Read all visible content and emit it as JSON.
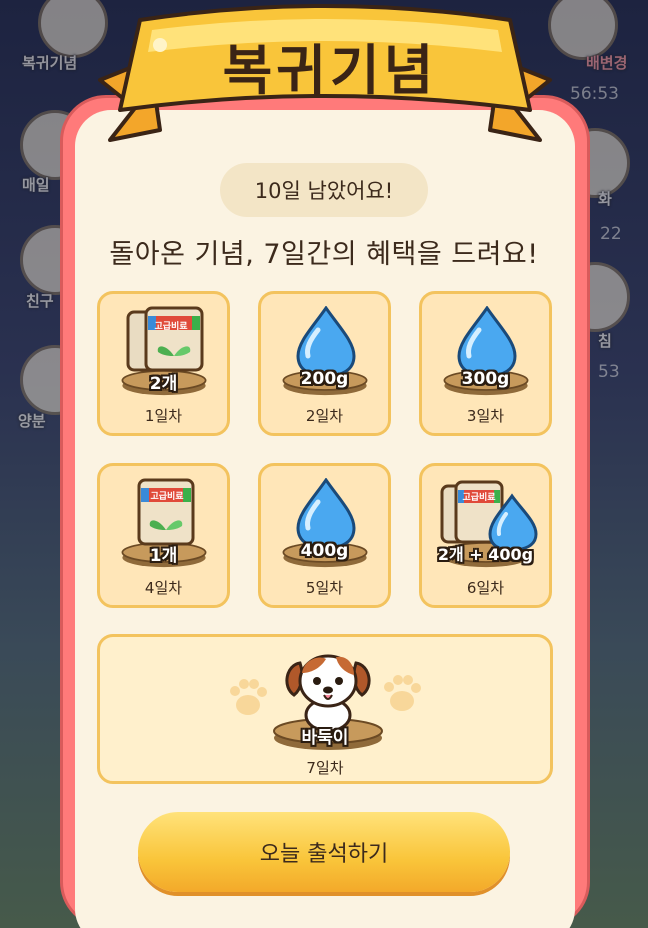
{
  "background": {
    "left_labels": [
      "복귀기념",
      "매일",
      "친구",
      "양분"
    ],
    "right_labels": [
      "배변경",
      "화",
      "침"
    ],
    "timers": [
      "56:53",
      "22",
      "53"
    ]
  },
  "modal": {
    "title": "복귀기념",
    "days_left": "10일 남았어요!",
    "subtitle": "돌아온 기념, 7일간의 혜택을 드려요!",
    "rewards": [
      {
        "day": "1일차",
        "qty": "2개",
        "icon": "fertilizer-bag-icon",
        "bag_label": "고급비료"
      },
      {
        "day": "2일차",
        "qty": "200g",
        "icon": "water-drop-icon"
      },
      {
        "day": "3일차",
        "qty": "300g",
        "icon": "water-drop-icon"
      },
      {
        "day": "4일차",
        "qty": "1개",
        "icon": "fertilizer-bag-icon",
        "bag_label": "고급비료"
      },
      {
        "day": "5일차",
        "qty": "400g",
        "icon": "water-drop-icon"
      },
      {
        "day": "6일차",
        "qty": "2개 + 400g",
        "icon": "fertilizer-and-water-icon",
        "bag_label": "고급비료"
      },
      {
        "day": "7일차",
        "qty": "바둑이",
        "icon": "puppy-icon"
      }
    ],
    "attend_button": "오늘 출석하기"
  },
  "colors": {
    "frame": "#ff7a7a",
    "panel": "#fbf3e2",
    "card": "#ffe6b8",
    "card_border": "#f3c35e",
    "ribbon": "#f9c53a",
    "button": "#f9c53a"
  }
}
